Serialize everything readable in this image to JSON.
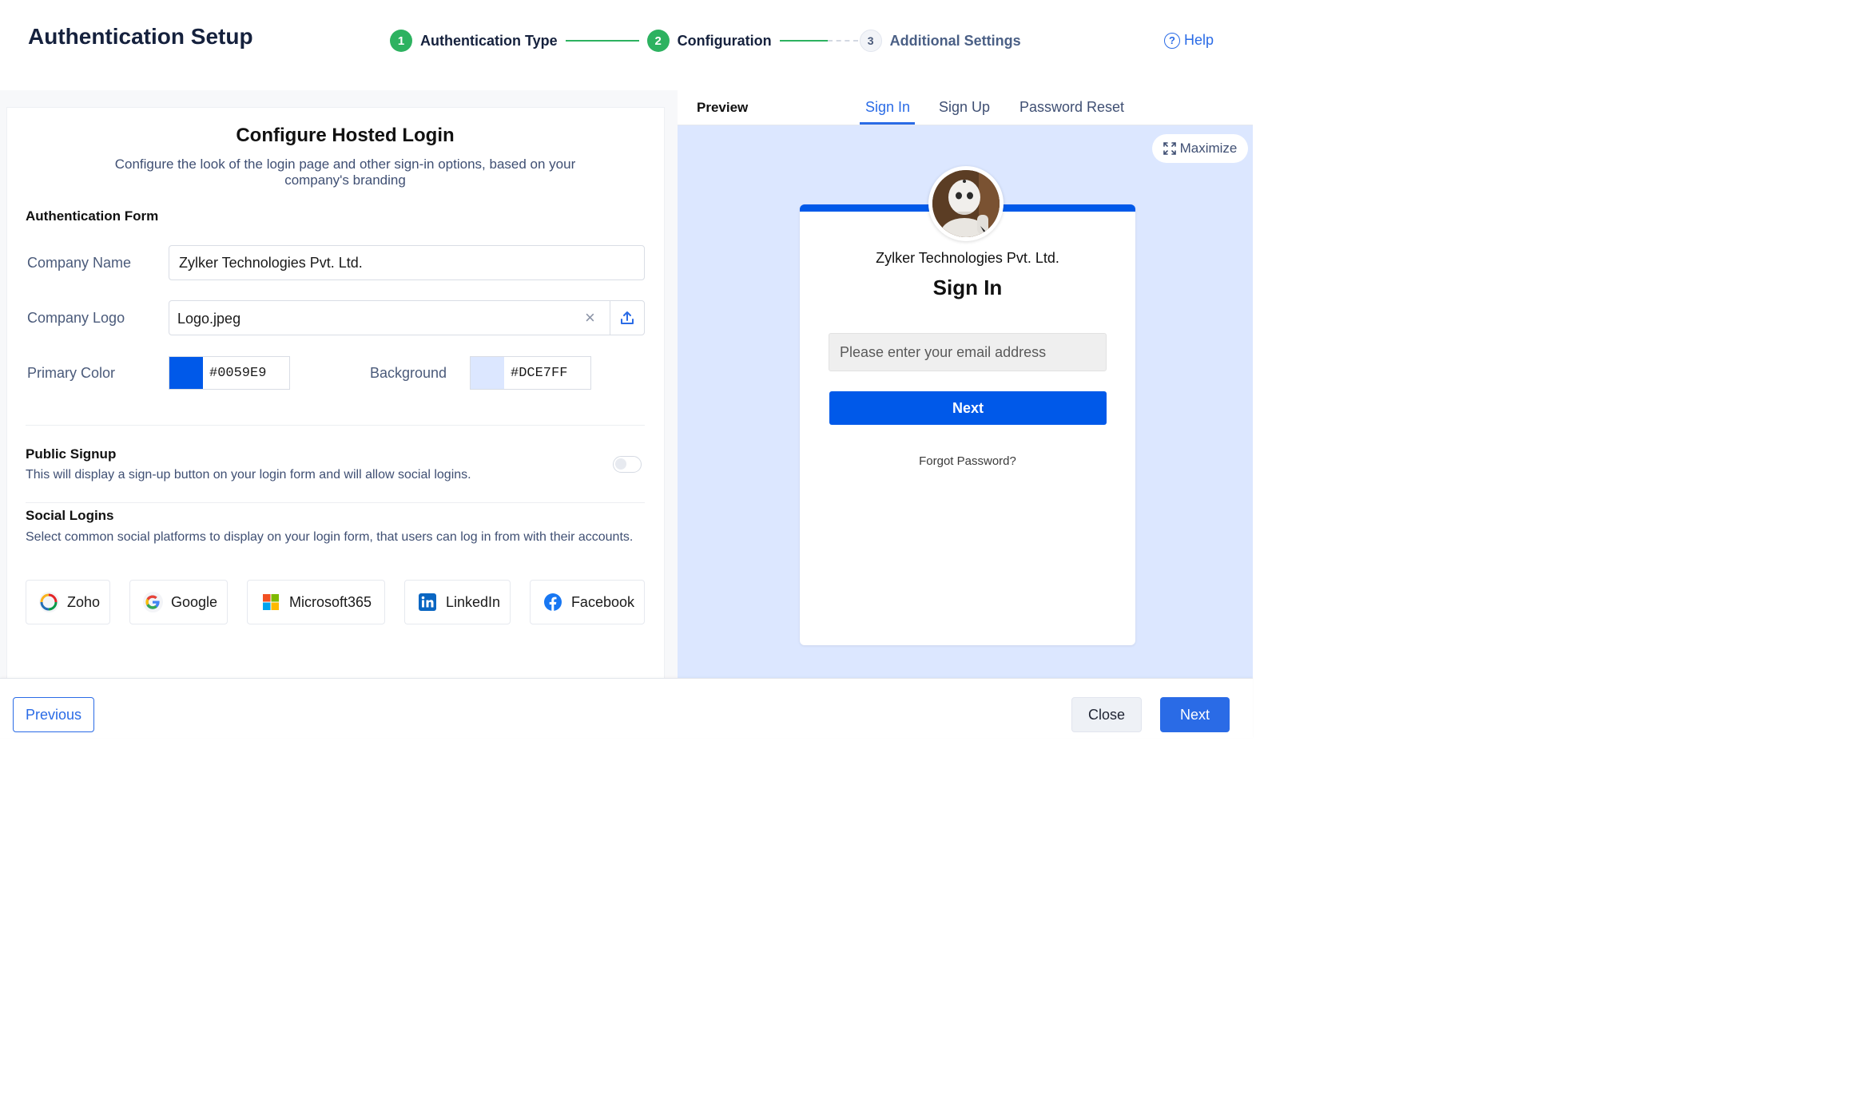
{
  "header": {
    "title": "Authentication Setup",
    "help_label": "Help",
    "help_icon": "help-circle-icon",
    "steps": [
      {
        "number": "1",
        "label": "Authentication Type",
        "status": "complete"
      },
      {
        "number": "2",
        "label": "Configuration",
        "status": "complete"
      },
      {
        "number": "3",
        "label": "Additional Settings",
        "status": "pending"
      }
    ]
  },
  "form": {
    "title": "Configure Hosted Login",
    "subtitle": "Configure the look of the login page and other sign-in options, based on your company's branding",
    "auth_form_heading": "Authentication Form",
    "company_name_label": "Company Name",
    "company_name_value": "Zylker Technologies Pvt. Ltd.",
    "company_logo_label": "Company Logo",
    "company_logo_value": "Logo.jpeg",
    "clear_symbol": "×",
    "primary_color_label": "Primary Color",
    "primary_color_value": "#0059E9",
    "background_label": "Background",
    "background_value": "#DCE7FF",
    "public_signup_heading": "Public Signup",
    "public_signup_desc": "This will display a sign-up button on your login form and will allow social logins.",
    "public_signup_enabled": false,
    "social_heading": "Social Logins",
    "social_desc": "Select common social platforms to display on your login form, that users can log in from with their accounts.",
    "social_providers": [
      {
        "label": "Zoho",
        "icon": "zoho-icon"
      },
      {
        "label": "Google",
        "icon": "google-icon"
      },
      {
        "label": "Microsoft365",
        "icon": "microsoft-icon"
      },
      {
        "label": "LinkedIn",
        "icon": "linkedin-icon"
      },
      {
        "label": "Facebook",
        "icon": "facebook-icon"
      }
    ]
  },
  "preview": {
    "label": "Preview",
    "tabs": [
      "Sign In",
      "Sign Up",
      "Password Reset"
    ],
    "active_tab": "Sign In",
    "maximize_label": "Maximize",
    "card": {
      "company": "Zylker Technologies Pvt. Ltd.",
      "title": "Sign In",
      "email_placeholder": "Please enter your email address",
      "next_label": "Next",
      "forgot_label": "Forgot Password?"
    }
  },
  "footer": {
    "previous_label": "Previous",
    "close_label": "Close",
    "next_label": "Next"
  },
  "colors": {
    "accent": "#2a6be6",
    "step_complete": "#2db260",
    "primary": "#0059E9",
    "preview_background": "#DCE7FF"
  }
}
